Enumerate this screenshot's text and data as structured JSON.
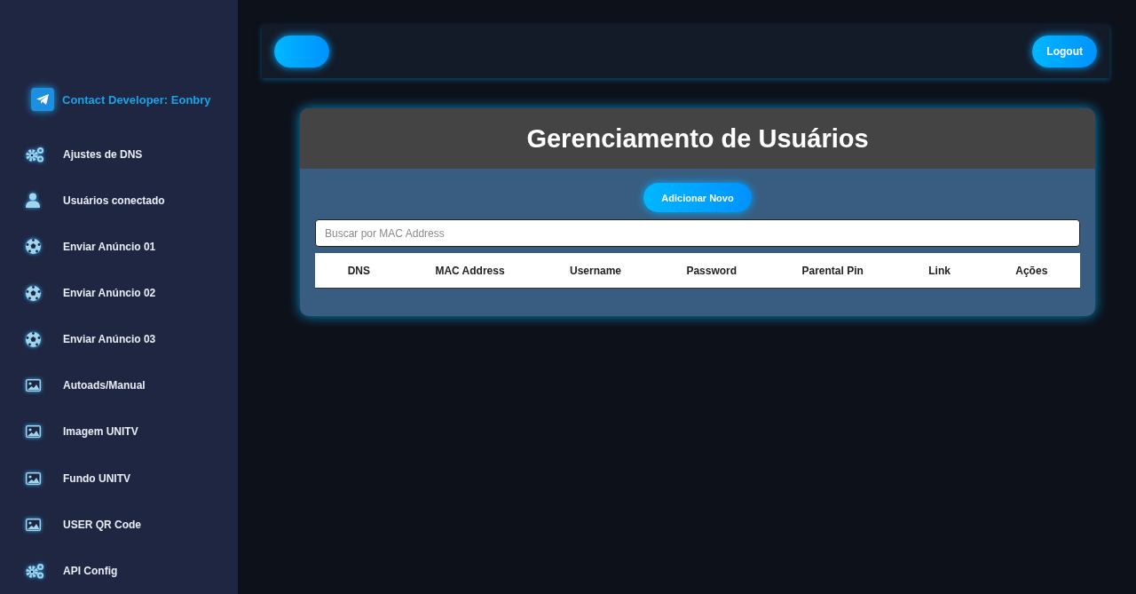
{
  "sidebar": {
    "contact": {
      "label": "Contact Developer: Eonbry"
    },
    "items": [
      {
        "label": "Ajustes de DNS",
        "kind": "gears"
      },
      {
        "label": "Usuários conectado",
        "kind": "user"
      },
      {
        "label": "Enviar Anúncio 01",
        "kind": "ball"
      },
      {
        "label": "Enviar Anúncio 02",
        "kind": "ball"
      },
      {
        "label": "Enviar Anúncio 03",
        "kind": "ball"
      },
      {
        "label": "Autoads/Manual",
        "kind": "image"
      },
      {
        "label": "Imagem UNITV",
        "kind": "image"
      },
      {
        "label": "Fundo UNITV",
        "kind": "image"
      },
      {
        "label": "USER QR Code",
        "kind": "image"
      },
      {
        "label": "API Config",
        "kind": "gears"
      }
    ]
  },
  "header": {
    "logout": "Logout"
  },
  "card": {
    "title": "Gerenciamento de Usuários",
    "add_button": "Adicionar Novo",
    "search": {
      "placeholder": "Buscar por MAC Address"
    },
    "table": {
      "columns": [
        "DNS",
        "MAC Address",
        "Username",
        "Password",
        "Parental Pin",
        "Link",
        "Ações"
      ]
    }
  }
}
